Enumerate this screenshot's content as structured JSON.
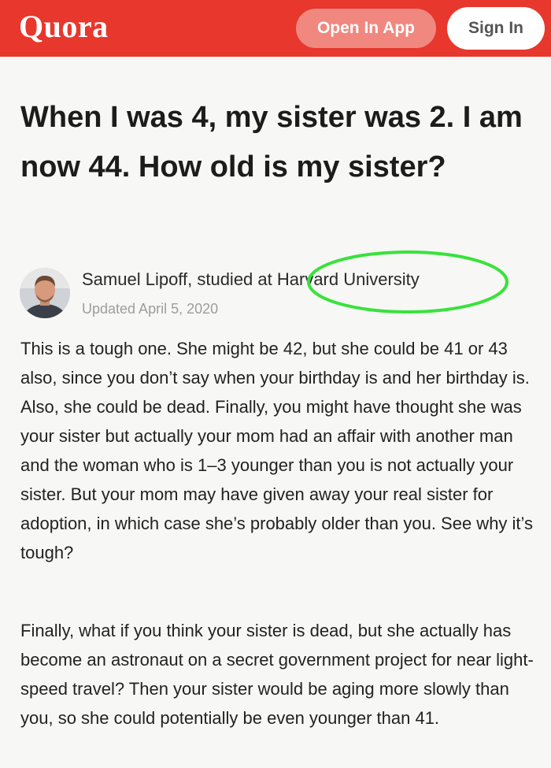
{
  "header": {
    "logo": "Quora",
    "open_in_app_label": "Open In App",
    "sign_in_label": "Sign In",
    "brand_color": "#e8372d"
  },
  "question": {
    "title": "When I was 4, my sister was 2. I am now 44. How old is my sister?"
  },
  "answer": {
    "author_credential": "Samuel Lipoff, studied at Harvard University",
    "updated": "Updated April 5, 2020",
    "highlight_color": "#39e23c",
    "paragraphs": [
      "This is a tough one. She might be 42, but she could be 41 or 43 also, since you don’t say when your birthday is and her birthday is. Also, she could be dead. Finally, you might have thought she was your sister but actually your mom had an affair with another man and the woman who is 1–3 younger than you is not actually your sister. But your mom may have given away your real sister for adoption, in which case she’s probably older than you. See why it’s tough?",
      "Finally, what if you think your sister is dead, but she actually has become an astronaut on a secret government project for near light-speed travel? Then your sister would be aging more slowly than you, so she could potentially be even younger than 41."
    ]
  }
}
